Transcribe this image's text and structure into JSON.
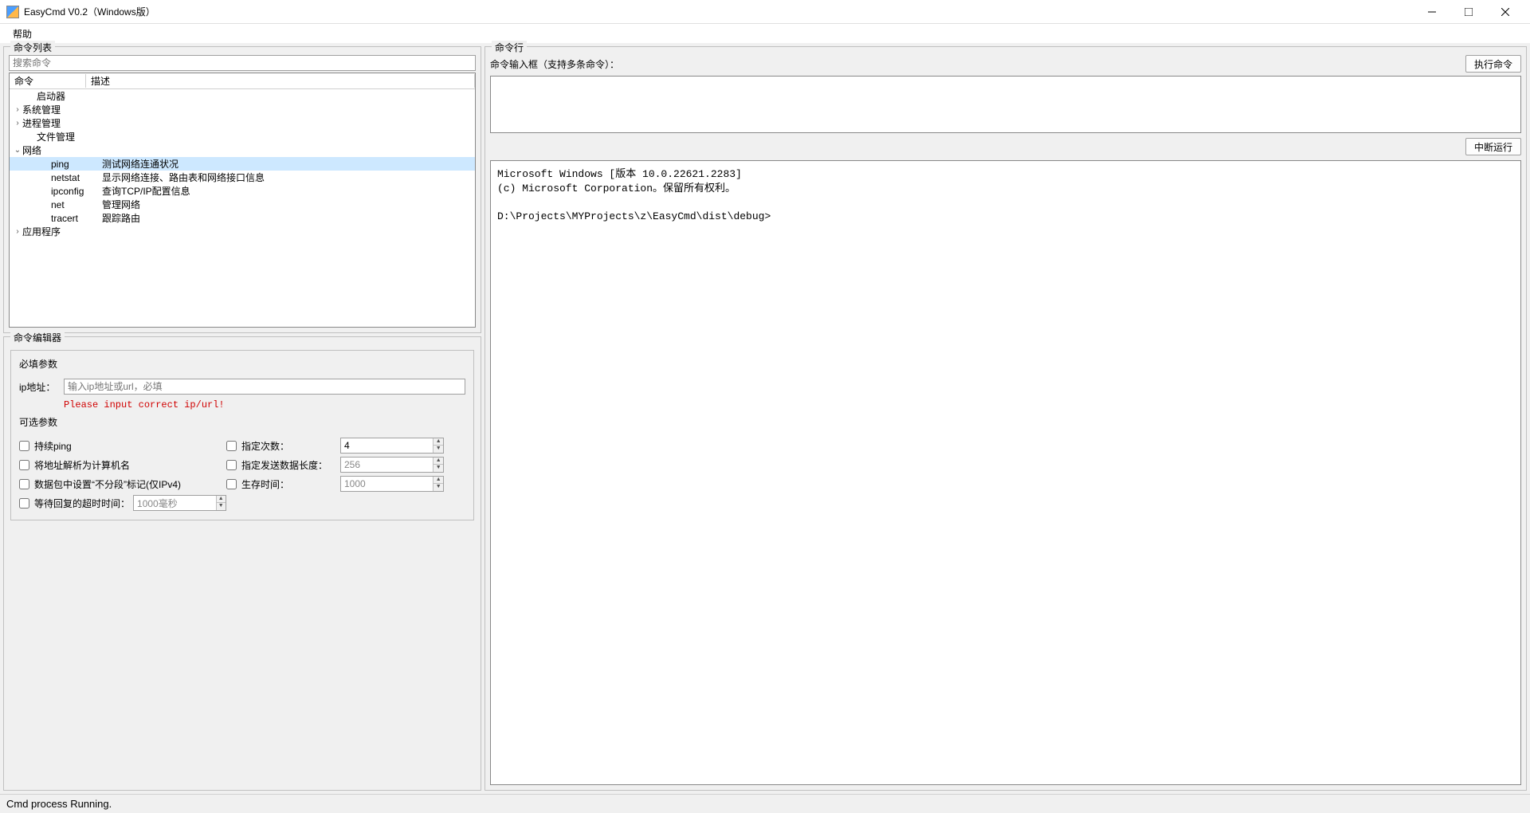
{
  "window": {
    "title": "EasyCmd V0.2（Windows版）"
  },
  "menu": {
    "help": "帮助"
  },
  "cmdlist": {
    "title": "命令列表",
    "search_placeholder": "搜索命令",
    "header_cmd": "命令",
    "header_desc": "描述",
    "rows": [
      {
        "indent": 1,
        "expander": "",
        "cmd": "启动器",
        "desc": "",
        "selected": false
      },
      {
        "indent": 0,
        "expander": "›",
        "cmd": "系统管理",
        "desc": "",
        "selected": false
      },
      {
        "indent": 0,
        "expander": "›",
        "cmd": "进程管理",
        "desc": "",
        "selected": false
      },
      {
        "indent": 1,
        "expander": "",
        "cmd": "文件管理",
        "desc": "",
        "selected": false
      },
      {
        "indent": 0,
        "expander": "⌄",
        "cmd": "网络",
        "desc": "",
        "selected": false
      },
      {
        "indent": 2,
        "expander": "",
        "cmd": "ping",
        "desc": "测试网络连通状况",
        "selected": true
      },
      {
        "indent": 2,
        "expander": "",
        "cmd": "netstat",
        "desc": "显示网络连接、路由表和网络接口信息",
        "selected": false
      },
      {
        "indent": 2,
        "expander": "",
        "cmd": "ipconfig",
        "desc": "查询TCP/IP配置信息",
        "selected": false
      },
      {
        "indent": 2,
        "expander": "",
        "cmd": "net",
        "desc": "管理网络",
        "selected": false
      },
      {
        "indent": 2,
        "expander": "",
        "cmd": "tracert",
        "desc": "跟踪路由",
        "selected": false
      },
      {
        "indent": 0,
        "expander": "›",
        "cmd": "应用程序",
        "desc": "",
        "selected": false
      }
    ]
  },
  "editor": {
    "title": "命令编辑器",
    "required_title": "必填参数",
    "ip_label": "ip地址：",
    "ip_placeholder": "输入ip地址或url，必填",
    "ip_error": "Please input correct ip/url!",
    "optional_title": "可选参数",
    "opts_left": [
      "持续ping",
      "将地址解析为计算机名",
      "数据包中设置“不分段”标记(仅IPv4)",
      "等待回复的超时时间："
    ],
    "timeout_value": "1000毫秒",
    "opts_right": [
      {
        "label": "指定次数：",
        "value": "4"
      },
      {
        "label": "指定发送数据长度：",
        "value": "256"
      },
      {
        "label": "生存时间：",
        "value": "1000"
      }
    ]
  },
  "cmdline": {
    "title": "命令行",
    "input_label": "命令输入框（支持多条命令）：",
    "run_btn": "执行命令",
    "stop_btn": "中断运行",
    "console_text": "Microsoft Windows [版本 10.0.22621.2283]\n(c) Microsoft Corporation。保留所有权利。\n\nD:\\Projects\\MYProjects\\z\\EasyCmd\\dist\\debug>"
  },
  "status": {
    "text": "Cmd process Running."
  }
}
